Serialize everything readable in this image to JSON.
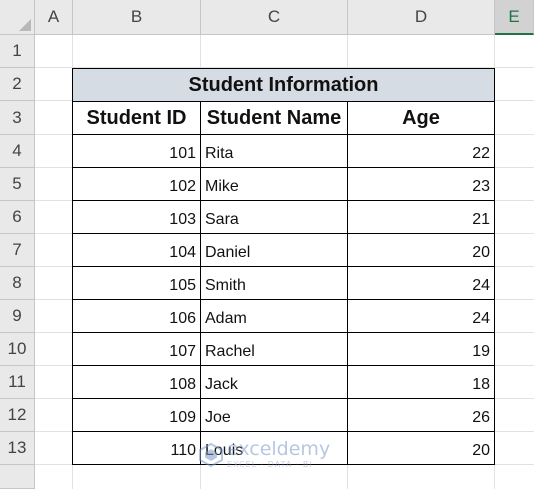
{
  "columns": [
    "A",
    "B",
    "C",
    "D",
    "E"
  ],
  "rows": [
    "1",
    "2",
    "3",
    "4",
    "5",
    "6",
    "7",
    "8",
    "9",
    "10",
    "11",
    "12",
    "13"
  ],
  "table": {
    "title": "Student Information",
    "headers": [
      "Student ID",
      "Student Name",
      "Age"
    ],
    "records": [
      {
        "id": "101",
        "name": "Rita",
        "age": "22"
      },
      {
        "id": "102",
        "name": "Mike",
        "age": "23"
      },
      {
        "id": "103",
        "name": "Sara",
        "age": "21"
      },
      {
        "id": "104",
        "name": "Daniel",
        "age": "20"
      },
      {
        "id": "105",
        "name": "Smith",
        "age": "24"
      },
      {
        "id": "106",
        "name": "Adam",
        "age": "24"
      },
      {
        "id": "107",
        "name": "Rachel",
        "age": "19"
      },
      {
        "id": "108",
        "name": "Jack",
        "age": "18"
      },
      {
        "id": "109",
        "name": "Joe",
        "age": "26"
      },
      {
        "id": "110",
        "name": "Louis",
        "age": "20"
      }
    ]
  },
  "watermark": {
    "name": "exceldemy",
    "sub": "EXCEL · DATA · BI"
  },
  "colors": {
    "active_col": "#217346",
    "title_fill": "#d6dce4"
  }
}
